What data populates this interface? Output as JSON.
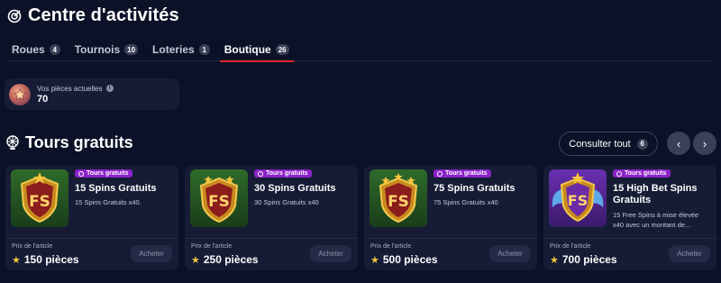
{
  "header": {
    "title": "Centre d'activités"
  },
  "tabs": [
    {
      "label": "Roues",
      "count": "4"
    },
    {
      "label": "Tournois",
      "count": "10"
    },
    {
      "label": "Loteries",
      "count": "1"
    },
    {
      "label": "Boutique",
      "count": "26",
      "active": true
    }
  ],
  "coins": {
    "label": "Vos pièces actuelles",
    "value": "70",
    "info": "i"
  },
  "section": {
    "title": "Tours gratuits",
    "see_all_label": "Consulter tout",
    "see_all_count": "6",
    "prev_icon": "‹",
    "next_icon": "›"
  },
  "cards": [
    {
      "badge": "Tours gratuits",
      "title": "15 Spins Gratuits",
      "desc": "15 Spins Gratuits x40.",
      "price_label": "Prix de l'article",
      "price": "150 pièces",
      "buy_label": "Acheter",
      "thumb_text": "FS"
    },
    {
      "badge": "Tours gratuits",
      "title": "30 Spins Gratuits",
      "desc": "30 Spins Gratuits x40",
      "price_label": "Prix de l'article",
      "price": "250 pièces",
      "buy_label": "Acheter",
      "thumb_text": "FS"
    },
    {
      "badge": "Tours gratuits",
      "title": "75 Spins Gratuits",
      "desc": "75 Spins Gratuits x40",
      "price_label": "Prix de l'article",
      "price": "500 pièces",
      "buy_label": "Acheter",
      "thumb_text": "FS"
    },
    {
      "badge": "Tours gratuits",
      "title": "15 High Bet Spins Gratuits",
      "desc": "15 Free Spins à mise élevée x40 avec un montant de...",
      "price_label": "Prix de l'article",
      "price": "700 pièces",
      "buy_label": "Acheter",
      "thumb_text": "FS"
    }
  ]
}
